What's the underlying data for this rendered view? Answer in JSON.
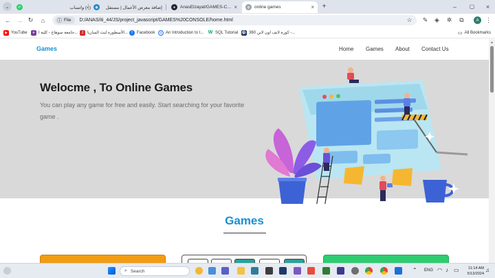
{
  "browser": {
    "tabs": [
      {
        "title": "(4) واتساب",
        "active": false,
        "icon": "whatsapp-icon"
      },
      {
        "title": "إضافة معرض الأعمال | مستقل",
        "active": false,
        "icon": "mostaql-icon"
      },
      {
        "title": "AnasElzayat/GAMES-CONSOLE",
        "active": false,
        "icon": "github-icon"
      },
      {
        "title": "online games",
        "active": true,
        "icon": "globe-icon"
      }
    ],
    "address": {
      "scheme_label": "File",
      "url": "D:/ANAS/iti_44/JS/project_javascript/GAMES%20CONSOLE/home.html"
    },
    "profile_initial": "A",
    "bookmarks": [
      {
        "label": "YouTube",
        "icon": "youtube-icon"
      },
      {
        "label": "جامعة سوهاج - كلية ا...",
        "icon": "university-icon"
      },
      {
        "label": "الأسطورة لبث المباريا...",
        "icon": "stream-icon"
      },
      {
        "label": "Facebook",
        "icon": "facebook-icon"
      },
      {
        "label": "An Introduction to I...",
        "icon": "bookmark-globe-icon"
      },
      {
        "label": "SQL Tutorial",
        "icon": "w3schools-icon"
      },
      {
        "label": "360 كورة لايف اون لاين -...",
        "icon": "soccer-icon"
      }
    ],
    "all_bookmarks_label": "All Bookmarks"
  },
  "site": {
    "brand": "Games",
    "nav": [
      "Home",
      "Games",
      "About",
      "Contact Us"
    ],
    "hero": {
      "title": "Welocme , To Online Games",
      "text": "You can play any game for free and easily. Start searching for your favorite game ."
    },
    "section_title": "Games"
  },
  "taskbar": {
    "search_placeholder": "Search",
    "language": "ENG",
    "time": "11:14 AM",
    "date": "5/13/2024"
  },
  "colors": {
    "accent_blue": "#1a8fd3",
    "hero_bg": "#d9d9d9",
    "card_orange": "#f39c12",
    "card_green": "#2ecc71"
  }
}
